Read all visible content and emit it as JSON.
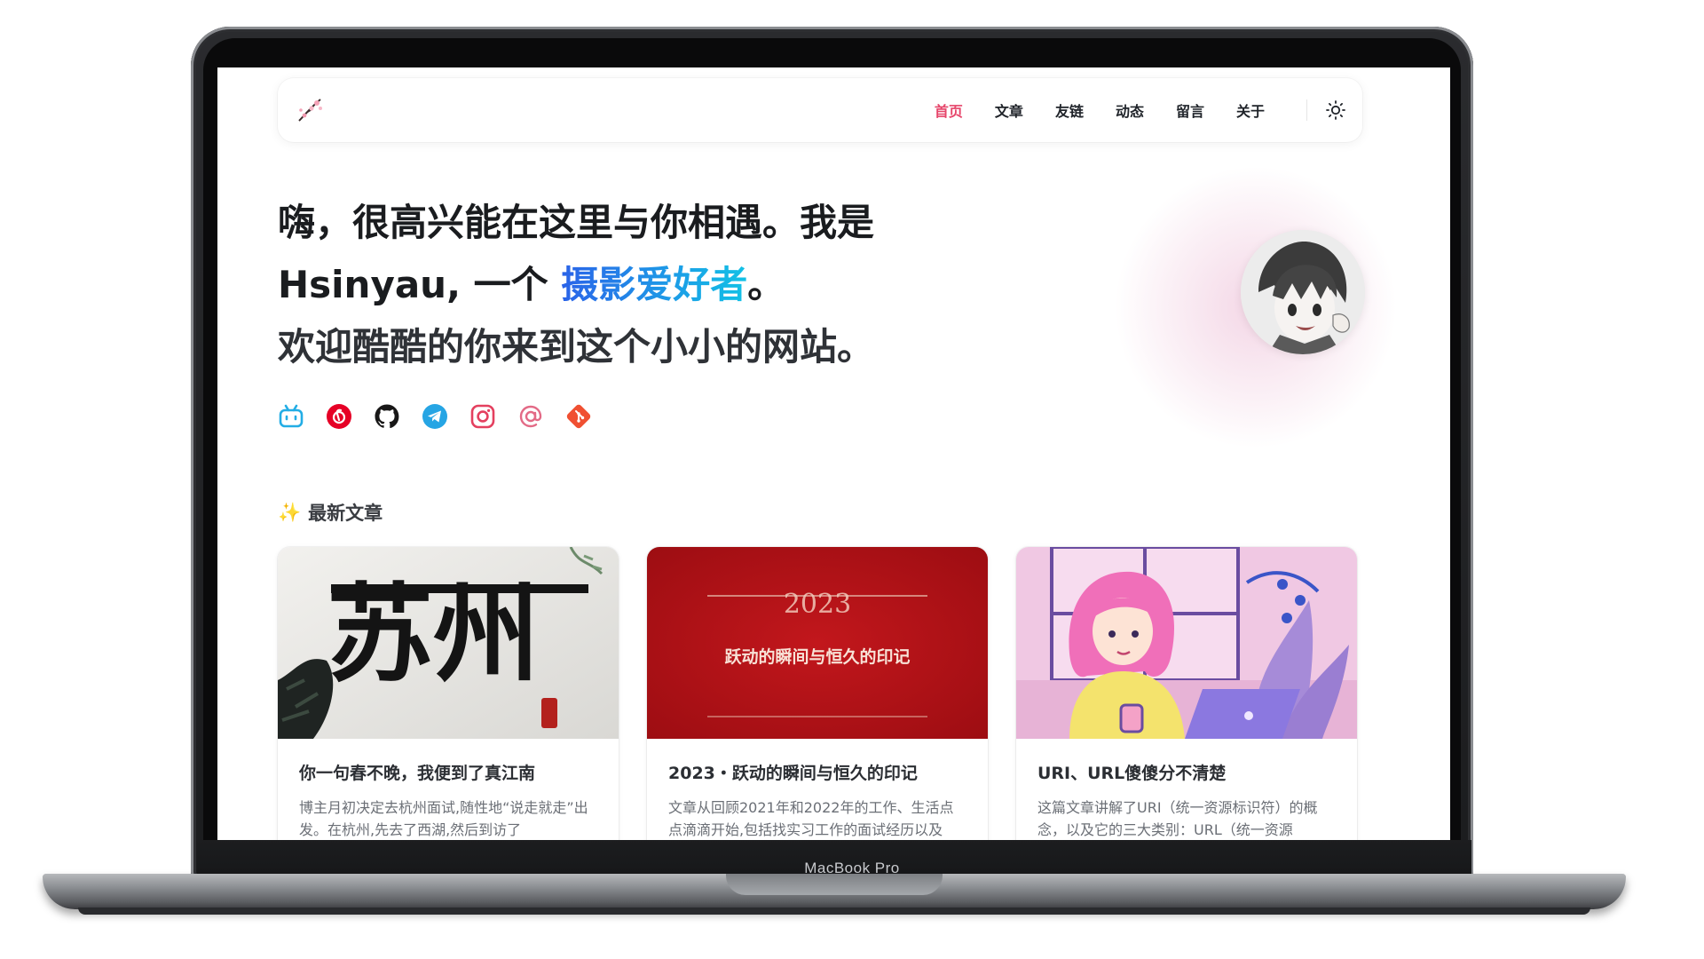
{
  "device": {
    "label": "MacBook Pro"
  },
  "nav": {
    "items": [
      {
        "label": "首页",
        "active": true
      },
      {
        "label": "文章",
        "active": false
      },
      {
        "label": "友链",
        "active": false
      },
      {
        "label": "动态",
        "active": false
      },
      {
        "label": "留言",
        "active": false
      },
      {
        "label": "关于",
        "active": false
      }
    ],
    "theme_icon": "sun-icon",
    "accent_color": "#e6456a"
  },
  "hero": {
    "line1": "嗨，很高兴能在这里与你相遇。我是",
    "line2_prefix": "Hsinyau, 一个 ",
    "line2_highlight": "摄影爱好者",
    "line2_suffix": "。",
    "line3": "欢迎酷酷的你来到这个小小的网站。"
  },
  "socials": [
    {
      "name": "bilibili-icon",
      "color": "#23ade5"
    },
    {
      "name": "netease-music-icon",
      "color": "#e60026"
    },
    {
      "name": "github-icon",
      "color": "#181717"
    },
    {
      "name": "telegram-icon",
      "color": "#26a5e4"
    },
    {
      "name": "instagram-icon",
      "color": "#e4405f"
    },
    {
      "name": "email-icon",
      "color": "#e36a86"
    },
    {
      "name": "git-icon",
      "color": "#f05032"
    }
  ],
  "section": {
    "emoji": "✨",
    "title": "最新文章"
  },
  "posts": [
    {
      "cover_text": "苏州",
      "title": "你一句春不晚，我便到了真江南",
      "desc": "博主月初决定去杭州面试,随性地“说走就走”出发。在杭州,先去了西湖,然后到访了"
    },
    {
      "cover_year": "2023",
      "cover_text": "跃动的瞬间与恒久的印记",
      "title": "2023・跃动的瞬间与恒久的印记",
      "desc": "文章从回顾2021年和2022年的工作、生活点点滴滴开始,包括找实习工作的面试经历以及"
    },
    {
      "title": "URI、URL傻傻分不清楚",
      "desc": "这篇文章讲解了URI（统一资源标识符）的概念，以及它的三大类别：URL（统一资源"
    }
  ]
}
